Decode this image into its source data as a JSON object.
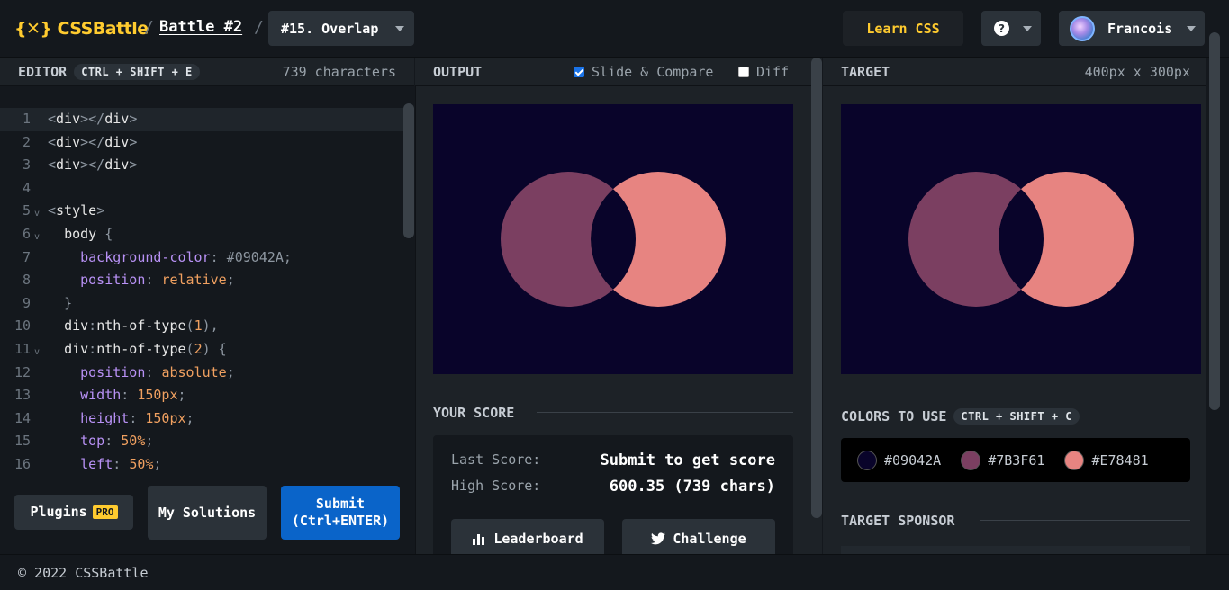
{
  "topbar": {
    "logo_mark": "{✕}",
    "logo_text": "CSSBattle",
    "separator": "/",
    "battle_label": "Battle #2",
    "level_label": "#15. Overlap",
    "learn_label": "Learn CSS",
    "help_glyph": "?",
    "user_name": "Francois"
  },
  "editor": {
    "title": "EDITOR",
    "shortcut": "CTRL + SHIFT + E",
    "char_count": "739 characters",
    "lines": [
      {
        "n": "1",
        "fold": "",
        "html": "<span class='t-punc'>&lt;</span><span class='t-tag'>div</span><span class='t-punc'>&gt;&lt;/</span><span class='t-tag'>div</span><span class='t-punc'>&gt;</span>"
      },
      {
        "n": "2",
        "fold": "",
        "html": "<span class='t-punc'>&lt;</span><span class='t-tag'>div</span><span class='t-punc'>&gt;&lt;/</span><span class='t-tag'>div</span><span class='t-punc'>&gt;</span>"
      },
      {
        "n": "3",
        "fold": "",
        "html": "<span class='t-punc'>&lt;</span><span class='t-tag'>div</span><span class='t-punc'>&gt;&lt;/</span><span class='t-tag'>div</span><span class='t-punc'>&gt;</span>"
      },
      {
        "n": "4",
        "fold": "",
        "html": ""
      },
      {
        "n": "5",
        "fold": "v",
        "html": "<span class='t-punc'>&lt;</span><span class='t-tag'>style</span><span class='t-punc'>&gt;</span>"
      },
      {
        "n": "6",
        "fold": "v",
        "html": "  <span class='t-sel'>body</span> <span class='t-punc'>{</span>"
      },
      {
        "n": "7",
        "fold": "",
        "html": "    <span class='t-prop'>background-color</span><span class='t-punc'>:</span> <span class='t-hex'>#09042A</span><span class='t-punc'>;</span>"
      },
      {
        "n": "8",
        "fold": "",
        "html": "    <span class='t-prop'>position</span><span class='t-punc'>:</span> <span class='t-val'>relative</span><span class='t-punc'>;</span>"
      },
      {
        "n": "9",
        "fold": "",
        "html": "  <span class='t-punc'>}</span>"
      },
      {
        "n": "10",
        "fold": "",
        "html": "  <span class='t-sel'>div</span><span class='t-punc'>:</span><span class='t-sel'>nth-of-type</span><span class='t-punc'>(</span><span class='t-val'>1</span><span class='t-punc'>),</span>"
      },
      {
        "n": "11",
        "fold": "v",
        "html": "  <span class='t-sel'>div</span><span class='t-punc'>:</span><span class='t-sel'>nth-of-type</span><span class='t-punc'>(</span><span class='t-val'>2</span><span class='t-punc'>) {</span>"
      },
      {
        "n": "12",
        "fold": "",
        "html": "    <span class='t-prop'>position</span><span class='t-punc'>:</span> <span class='t-val'>absolute</span><span class='t-punc'>;</span>"
      },
      {
        "n": "13",
        "fold": "",
        "html": "    <span class='t-prop'>width</span><span class='t-punc'>:</span> <span class='t-val'>150px</span><span class='t-punc'>;</span>"
      },
      {
        "n": "14",
        "fold": "",
        "html": "    <span class='t-prop'>height</span><span class='t-punc'>:</span> <span class='t-val'>150px</span><span class='t-punc'>;</span>"
      },
      {
        "n": "15",
        "fold": "",
        "html": "    <span class='t-prop'>top</span><span class='t-punc'>:</span> <span class='t-val'>50%</span><span class='t-punc'>;</span>"
      },
      {
        "n": "16",
        "fold": "",
        "html": "    <span class='t-prop'>left</span><span class='t-punc'>:</span> <span class='t-val'>50%</span><span class='t-punc'>;</span>"
      }
    ],
    "plugins_label": "Plugins",
    "pro_label": "PRO",
    "my_solutions_label": "My Solutions",
    "submit_label": "Submit (Ctrl+ENTER)"
  },
  "output": {
    "title": "OUTPUT",
    "slide_compare_label": "Slide & Compare",
    "slide_compare_checked": true,
    "diff_label": "Diff",
    "diff_checked": false
  },
  "score": {
    "title": "YOUR SCORE",
    "last_label": "Last Score:",
    "last_value": "Submit to get score",
    "high_label": "High Score:",
    "high_value": "600.35 (739 chars)",
    "leaderboard_label": "Leaderboard",
    "challenge_label": "Challenge"
  },
  "target": {
    "title": "TARGET",
    "dims": "400px x 300px",
    "colors_title": "COLORS TO USE",
    "colors_shortcut": "CTRL + SHIFT + C",
    "colors": [
      {
        "label": "#09042A",
        "hex": "#09042A"
      },
      {
        "label": "#7B3F61",
        "hex": "#7B3F61"
      },
      {
        "label": "#E78481",
        "hex": "#E78481"
      }
    ],
    "sponsor_title": "TARGET SPONSOR"
  },
  "art": {
    "background": "#09042A",
    "left_circle": "#7B3F61",
    "right_circle": "#E78481"
  },
  "footer": {
    "copyright": "© 2022 CSSBattle"
  }
}
